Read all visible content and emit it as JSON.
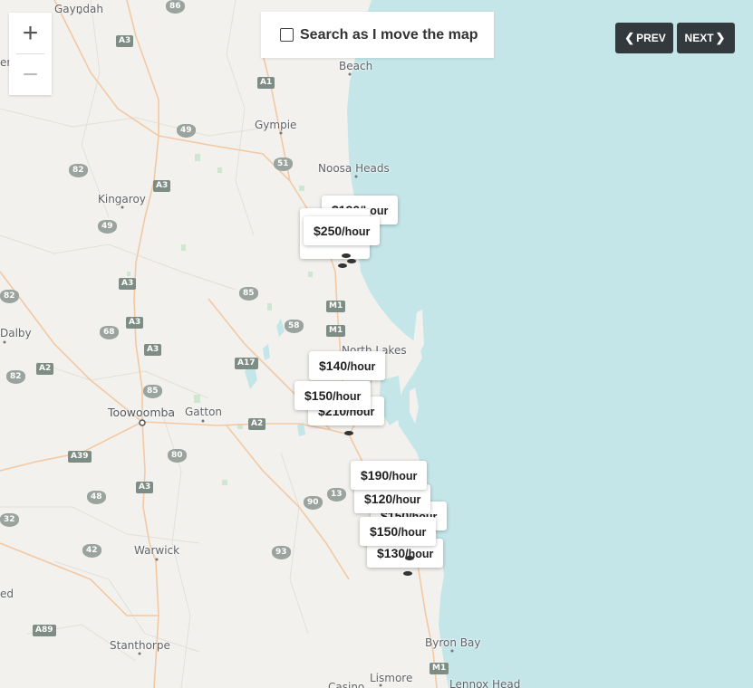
{
  "controls": {
    "zoom_in": "+",
    "zoom_out": "−",
    "search_label": "Search as I move the map",
    "search_checked": false,
    "prev_label": "PREV",
    "next_label": "NEXT"
  },
  "places": [
    {
      "name": "Gayndah",
      "icon": ""
    },
    {
      "name": "Beach"
    },
    {
      "name": "Gympie"
    },
    {
      "name": "Noosa Heads"
    },
    {
      "name": "Kingaroy"
    },
    {
      "name": "Dalby"
    },
    {
      "name": "Toowoomba"
    },
    {
      "name": "Gatton"
    },
    {
      "name": "North Lakes"
    },
    {
      "name": "Warwick"
    },
    {
      "name": "Stanthorpe"
    },
    {
      "name": "Byron Bay"
    },
    {
      "name": "Lismore"
    },
    {
      "name": "Lennox Head"
    },
    {
      "name": "era"
    },
    {
      "name": "ed"
    },
    {
      "name": "Casino"
    }
  ],
  "road_shields": [
    "86",
    "A3",
    "A1",
    "49",
    "82",
    "51",
    "A3",
    "49",
    "A3",
    "85",
    "M1",
    "58",
    "M1",
    "A3",
    "A3",
    "A17",
    "68",
    "82",
    "A2",
    "85",
    "A2",
    "A39",
    "80",
    "A3",
    "48",
    "13",
    "90",
    "42",
    "93",
    "A89",
    "M1",
    "32",
    "82"
  ],
  "listings": [
    {
      "price": "$190",
      "unit": "/hour"
    },
    {
      "price": "$250",
      "unit": "/hour"
    },
    {
      "price": "$140",
      "unit": "/hour"
    },
    {
      "price": "$150",
      "unit": "/hour"
    },
    {
      "price": "$210",
      "unit": "/hour"
    },
    {
      "price": "$190",
      "unit": "/hour"
    },
    {
      "price": "$120",
      "unit": "/hour"
    },
    {
      "price": "$150",
      "unit": "/hour"
    },
    {
      "price": "$150",
      "unit": "/hour"
    },
    {
      "price": "$130",
      "unit": "/hour"
    }
  ],
  "colors": {
    "land": "#f2f1ed",
    "water": "#c4e6e9",
    "road_major": "#f3c9a4",
    "button_dark": "#333a3e"
  }
}
